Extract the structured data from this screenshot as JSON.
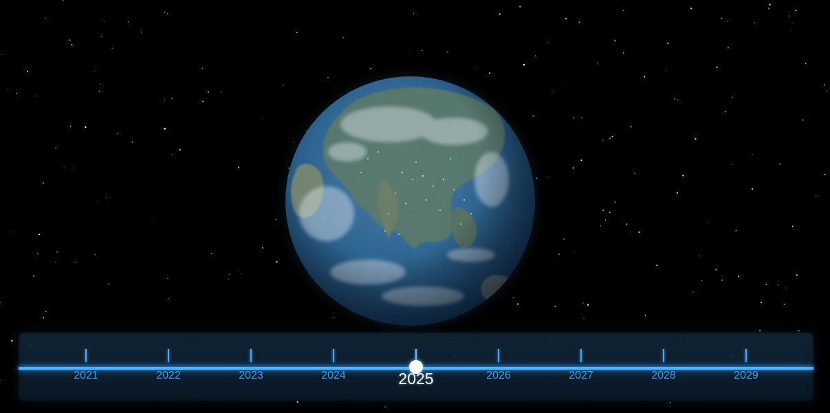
{
  "timeline": {
    "years": [
      "2021",
      "2022",
      "2023",
      "2024",
      "2025",
      "2026",
      "2027",
      "2028",
      "2029"
    ],
    "selected_year": "2025",
    "selected_index": 4
  },
  "colors": {
    "accent": "#4fb0ff",
    "year_label": "#3d9de8",
    "selected_label": "#ffffff",
    "background": "#000000",
    "ocean": "#2a5f8f"
  },
  "icons": {
    "globe": "earth-globe-icon",
    "handle": "slider-handle"
  }
}
